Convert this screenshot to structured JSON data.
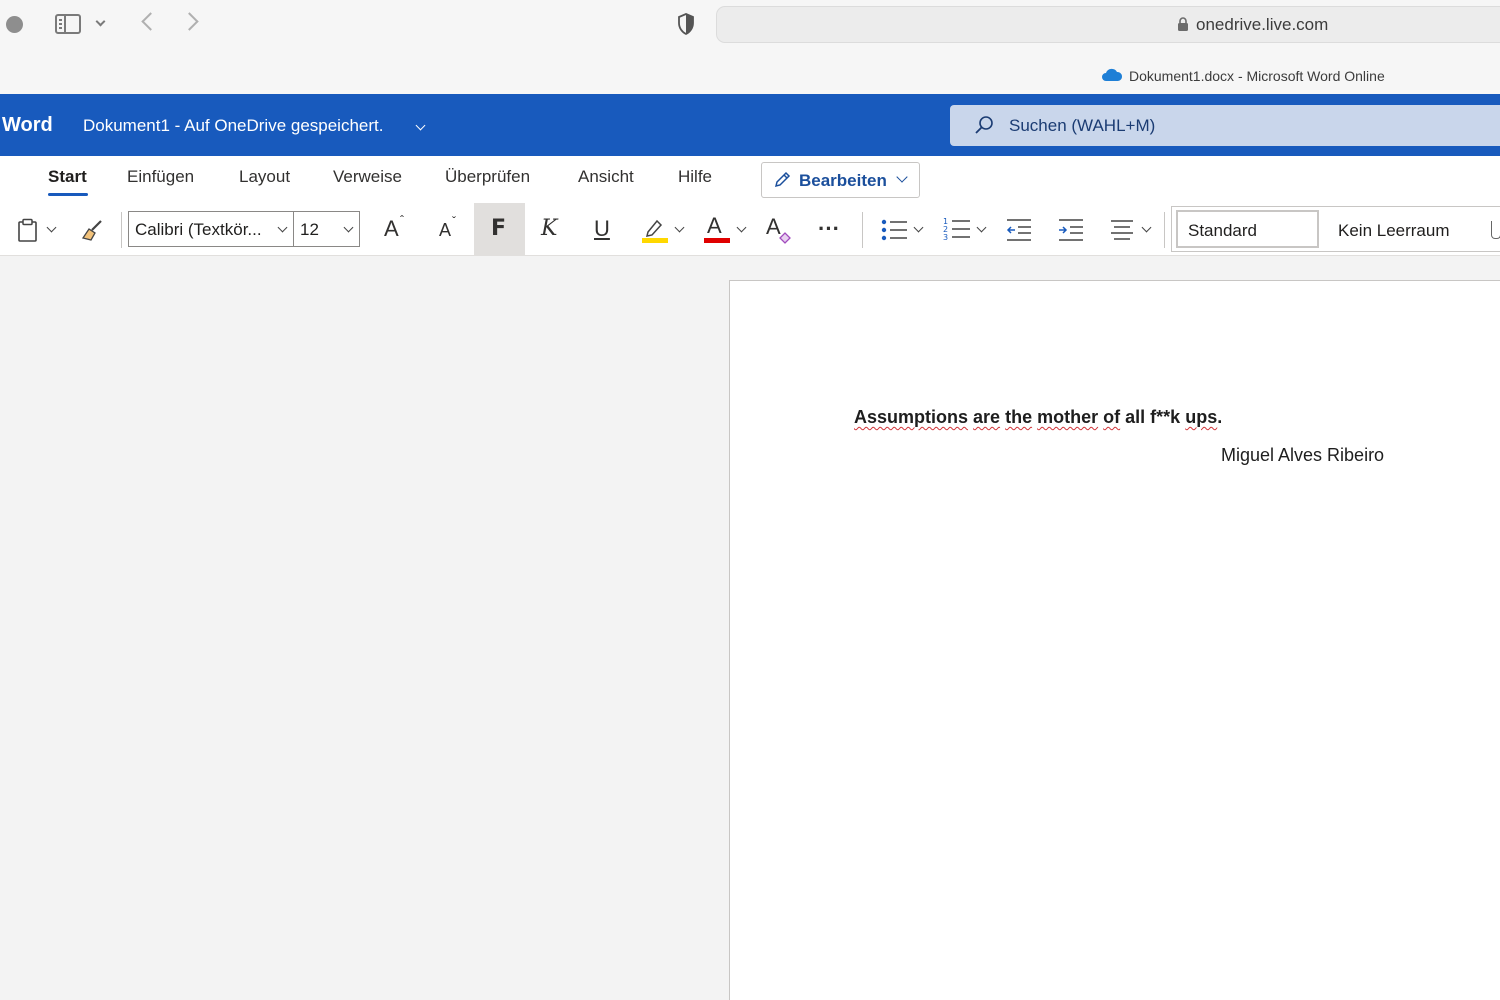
{
  "browser": {
    "url": "onedrive.live.com",
    "tab_title": "Dokument1.docx - Microsoft Word Online"
  },
  "titlebar": {
    "app_name": "Word",
    "doc_title": "Dokument1  -  Auf OneDrive gespeichert.",
    "search_placeholder": "Suchen (WAHL+M)",
    "color": "#185abd"
  },
  "ribbon": {
    "tabs": [
      "Start",
      "Einfügen",
      "Layout",
      "Verweise",
      "Überprüfen",
      "Ansicht",
      "Hilfe"
    ],
    "active_tab": "Start",
    "edit_mode_label": "Bearbeiten",
    "font_name": "Calibri (Textkör...",
    "font_size": "12",
    "grow_font_glyph": "A",
    "shrink_font_glyph": "A",
    "bold_glyph": "F",
    "italic_glyph": "K",
    "underline_glyph": "U",
    "font_color_glyph": "A",
    "clear_format_glyph": "A",
    "more_glyph": "···",
    "styles": [
      "Standard",
      "Kein Leerraum"
    ],
    "highlight_color": "#ffd800",
    "font_color": "#e00000"
  },
  "document": {
    "quote_words": [
      "Assumptions",
      "are",
      "the",
      "mother",
      "of",
      "all",
      "f**k",
      "ups"
    ],
    "quote_end": ".",
    "author": "Miguel Alves Ribeiro"
  }
}
